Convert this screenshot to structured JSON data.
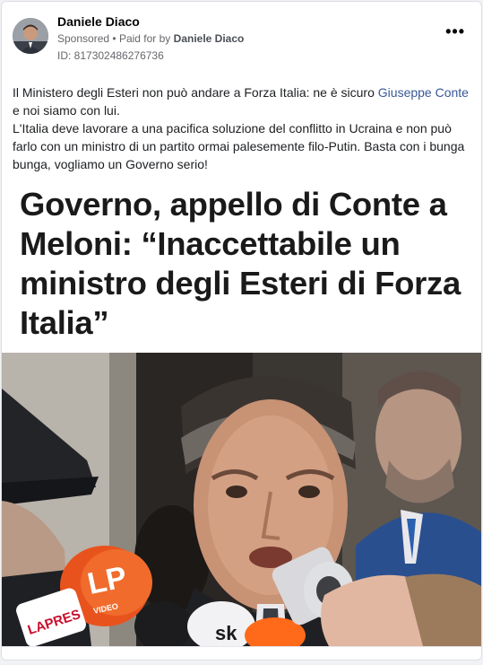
{
  "post": {
    "author_name": "Daniele Diaco",
    "sponsored_label": "Sponsored",
    "separator": "•",
    "paid_for_prefix": "Paid for by",
    "paid_for_name": "Daniele Diaco",
    "ad_id": "ID: 817302486276736",
    "more_label": "•••",
    "text_line1_part1": "Il Ministero degli Esteri non può andare a Forza Italia: ne è sicuro ",
    "text_link": "Giuseppe Conte",
    "text_line1_part2": " e noi siamo con lui.",
    "text_paragraph2": "L'Italia deve lavorare a una pacifica soluzione del conflitto in Ucraina e non può farlo con un ministro di un partito ormai palesemente filo-Putin. Basta con i bunga bunga, vogliamo un Governo serio!"
  },
  "creative": {
    "headline": "Governo, appello di Conte a Meloni: “Inaccettabile un ministro degli Esteri di Forza Italia”",
    "mic_lapresse": "LAPRES",
    "mic_lp": "LP",
    "mic_lp_sub": "VIDEO",
    "mic_sky": "sk"
  },
  "colors": {
    "link": "#385898",
    "headline": "#1a1a1a",
    "mic_orange": "#e8531d",
    "suit_blue": "#2a4f8f"
  }
}
